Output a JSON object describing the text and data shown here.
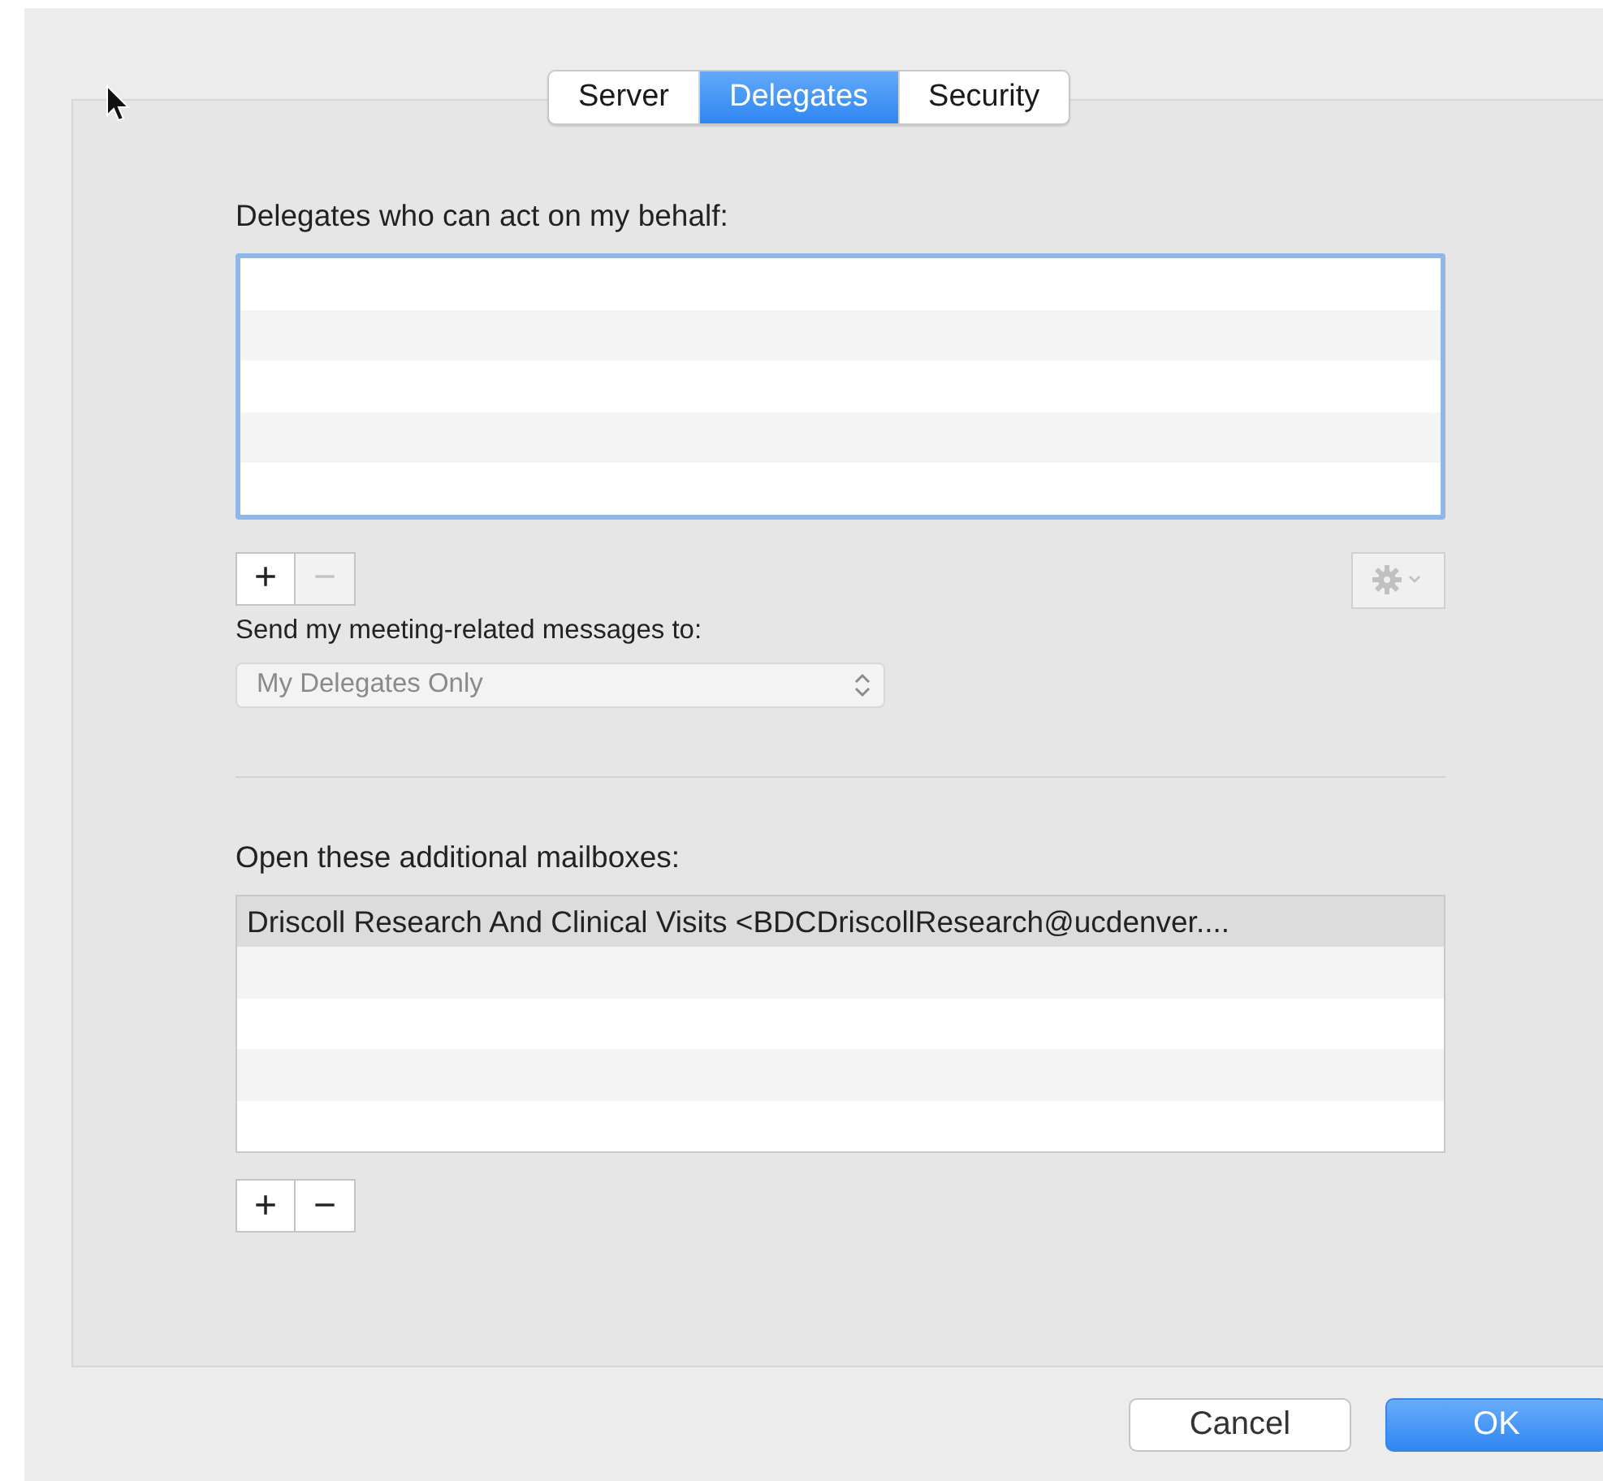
{
  "tabs": [
    {
      "label": "Server",
      "selected": false
    },
    {
      "label": "Delegates",
      "selected": true
    },
    {
      "label": "Security",
      "selected": false
    }
  ],
  "delegates": {
    "label": "Delegates who can act on my behalf:",
    "focused": true,
    "buttons": [
      {
        "label": "+",
        "disabled": false
      },
      {
        "label": "−",
        "disabled": true
      }
    ],
    "action_menu": {
      "disabled": true
    }
  },
  "meeting_messages": {
    "label": "Send my meeting-related messages to:",
    "value": "My Delegates Only",
    "disabled": true
  },
  "mailboxes": {
    "label": "Open these additional mailboxes:",
    "focused": false,
    "rows": [
      {
        "text": "Driscoll Research And Clinical Visits <BDCDriscollResearch@ucdenver....",
        "selected": true
      }
    ],
    "buttons": [
      {
        "label": "+",
        "disabled": false
      },
      {
        "label": "−",
        "disabled": false
      }
    ]
  },
  "footer_buttons": [
    {
      "kind": "cancel",
      "label": "Cancel"
    },
    {
      "kind": "ok",
      "label": "OK"
    }
  ]
}
